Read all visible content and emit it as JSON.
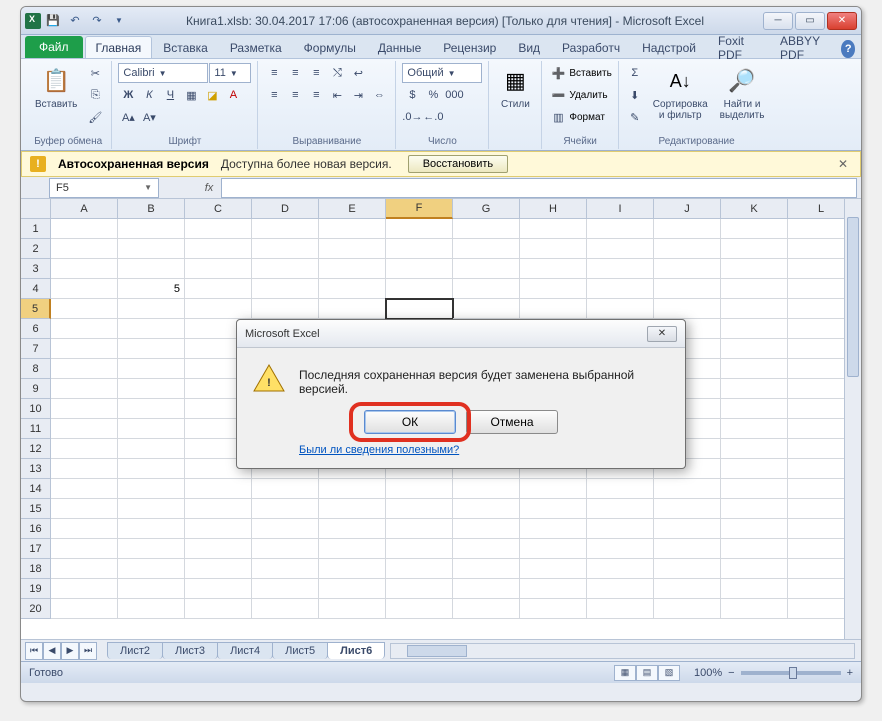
{
  "titlebar": {
    "title": "Книга1.xlsb: 30.04.2017 17:06 (автосохраненная версия)  [Только для чтения]  -  Microsoft Excel"
  },
  "tabs": {
    "file": "Файл",
    "items": [
      "Главная",
      "Вставка",
      "Разметка",
      "Формулы",
      "Данные",
      "Рецензиp",
      "Вид",
      "Разработч",
      "Надстрой",
      "Foxit PDF",
      "ABBYY PDF"
    ],
    "activeIndex": 0
  },
  "ribbon": {
    "clipboard": {
      "paste": "Вставить",
      "label": "Буфер обмена"
    },
    "font": {
      "name": "Calibri",
      "size": "11",
      "label": "Шрифт"
    },
    "align": {
      "label": "Выравнивание"
    },
    "number": {
      "format": "Общий",
      "label": "Число"
    },
    "styles": {
      "btn": "Стили"
    },
    "cells": {
      "insert": "Вставить",
      "delete": "Удалить",
      "format": "Формат",
      "label": "Ячейки"
    },
    "editing": {
      "sort": "Сортировка\nи фильтр",
      "find": "Найти и\nвыделить",
      "label": "Редактирование"
    }
  },
  "msgbar": {
    "title": "Автосохраненная версия",
    "text": "Доступна более новая версия.",
    "button": "Восстановить"
  },
  "namebox": "F5",
  "grid": {
    "cols": [
      "A",
      "B",
      "C",
      "D",
      "E",
      "F",
      "G",
      "H",
      "I",
      "J",
      "K",
      "L"
    ],
    "rows": 20,
    "selectedCol": 5,
    "selectedRow": 5,
    "data": {
      "B4": "5"
    }
  },
  "sheets": {
    "items": [
      "Лист2",
      "Лист3",
      "Лист4",
      "Лист5",
      "Лист6"
    ],
    "activeIndex": 4
  },
  "status": {
    "ready": "Готово",
    "zoom": "100%"
  },
  "dialog": {
    "title": "Microsoft Excel",
    "message": "Последняя сохраненная версия будет заменена выбранной версией.",
    "ok": "ОК",
    "cancel": "Отмена",
    "link": "Были ли сведения полезными?"
  }
}
